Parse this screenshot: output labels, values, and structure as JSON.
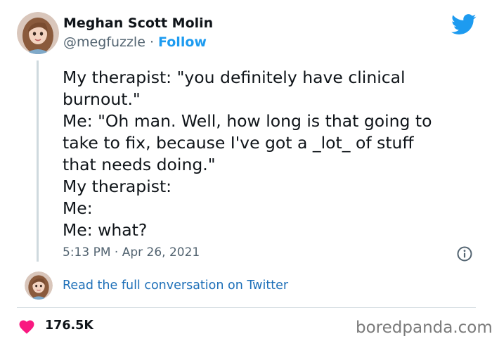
{
  "author": {
    "display_name": "Meghan Scott Molin",
    "handle": "@megfuzzle",
    "separator": "·",
    "follow_label": "Follow"
  },
  "tweet": {
    "text": "My therapist: \"you definitely have clinical\nburnout.\"\nMe: \"Oh man. Well, how long is that going to\ntake to fix, because I've got a _lot_ of stuff\nthat needs doing.\"\nMy therapist:\nMe:\nMe: what?",
    "timestamp": "5:13 PM · Apr 26, 2021"
  },
  "conversation_link": "Read the full conversation on Twitter",
  "engagement": {
    "likes": "176.5K"
  },
  "watermark": "boredpanda.com",
  "icons": {
    "brand": "twitter-bird-icon",
    "info": "info-icon",
    "like": "heart-icon"
  },
  "colors": {
    "twitter_blue": "#1d9bf0",
    "link_blue": "#1d6fb8",
    "heart_pink": "#f91880",
    "muted_text": "#536471",
    "divider": "#cfd9de"
  }
}
